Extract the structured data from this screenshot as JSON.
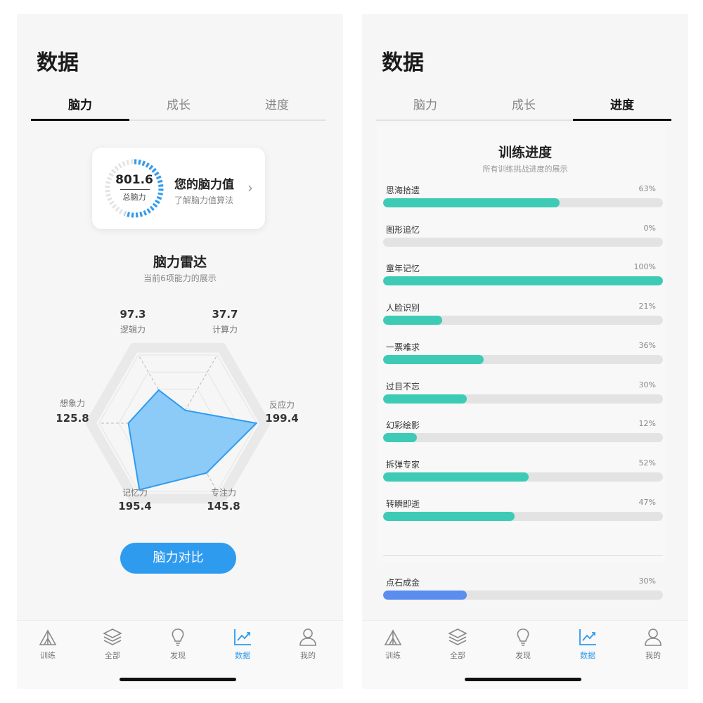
{
  "left": {
    "title": "数据",
    "tabs": [
      "脑力",
      "成长",
      "进度"
    ],
    "brain_card": {
      "value": "801.6",
      "value_label": "总脑力",
      "title": "您的脑力值",
      "link": "了解脑力值算法"
    },
    "radar": {
      "title": "脑力雷达",
      "subtitle": "当前6项能力的展示",
      "axes": [
        {
          "label": "逻辑力",
          "value": "97.3"
        },
        {
          "label": "计算力",
          "value": "37.7"
        },
        {
          "label": "反应力",
          "value": "199.4"
        },
        {
          "label": "专注力",
          "value": "145.8"
        },
        {
          "label": "记忆力",
          "value": "195.4"
        },
        {
          "label": "想象力",
          "value": "125.8"
        }
      ],
      "values": [
        97.3,
        37.7,
        199.4,
        145.8,
        195.4,
        125.8
      ],
      "max": 200,
      "fill_color": "#8ccaf7",
      "stroke_color": "#2f9bef"
    },
    "compare_button": "脑力对比"
  },
  "right": {
    "title": "数据",
    "tabs": [
      "脑力",
      "成长",
      "进度"
    ],
    "progress": {
      "title": "训练进度",
      "subtitle": "所有训练挑战进度的展示",
      "items": [
        {
          "name": "思海拾遗",
          "pct_label": "63%",
          "pct": 0.63
        },
        {
          "name": "图形追忆",
          "pct_label": "0%",
          "pct": 0
        },
        {
          "name": "童年记忆",
          "pct_label": "100%",
          "pct": 1.0
        },
        {
          "name": "人脸识别",
          "pct_label": "21%",
          "pct": 0.21
        },
        {
          "name": "一票难求",
          "pct_label": "36%",
          "pct": 0.36
        },
        {
          "name": "过目不忘",
          "pct_label": "30%",
          "pct": 0.3
        },
        {
          "name": "幻彩绘影",
          "pct_label": "12%",
          "pct": 0.12
        },
        {
          "name": "拆弹专家",
          "pct_label": "52%",
          "pct": 0.52
        },
        {
          "name": "转瞬即逝",
          "pct_label": "47%",
          "pct": 0.47
        }
      ],
      "extra_item": {
        "name": "点石成金",
        "pct_label": "30%",
        "pct": 0.3,
        "color": "#5b8def"
      },
      "bar_color": "#3ecbb5"
    }
  },
  "nav": [
    {
      "label": "训练",
      "icon": "tent-icon"
    },
    {
      "label": "全部",
      "icon": "layers-icon"
    },
    {
      "label": "发现",
      "icon": "lightbulb-icon"
    },
    {
      "label": "数据",
      "icon": "chart-icon",
      "active": true
    },
    {
      "label": "我的",
      "icon": "user-icon"
    }
  ],
  "colors": {
    "accent": "#2f9bef",
    "progress": "#3ecbb5"
  }
}
